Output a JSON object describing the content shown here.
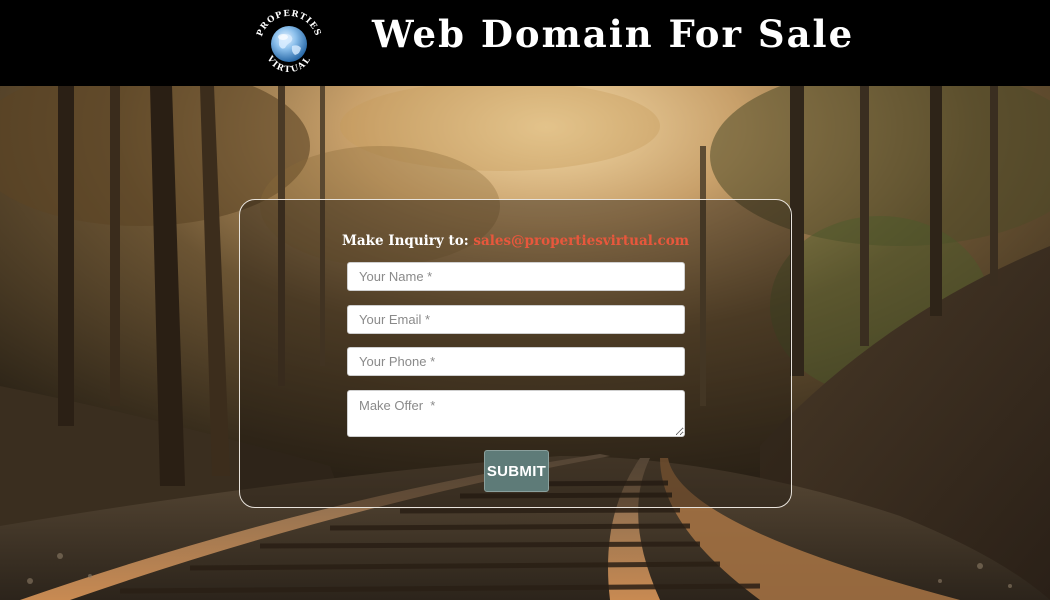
{
  "header": {
    "title": "Web Domain For Sale",
    "logo_text": "PROPERTIES VIRTUAL",
    "logo_icon": "globe-icon"
  },
  "form": {
    "inquiry_label": "Make Inquiry to:",
    "inquiry_email": "sales@propertiesvirtual.com",
    "fields": {
      "name_placeholder": "Your Name *",
      "email_placeholder": "Your Email *",
      "phone_placeholder": "Your Phone *",
      "offer_placeholder": "Make Offer  *"
    },
    "submit_label": "SUBMIT"
  },
  "background": {
    "scene": "railway-forest-photo"
  },
  "colors": {
    "header_bg": "#000000",
    "email_accent": "#e8573c",
    "submit_bg": "#5e7b78",
    "panel_border": "#e8e3dc"
  }
}
